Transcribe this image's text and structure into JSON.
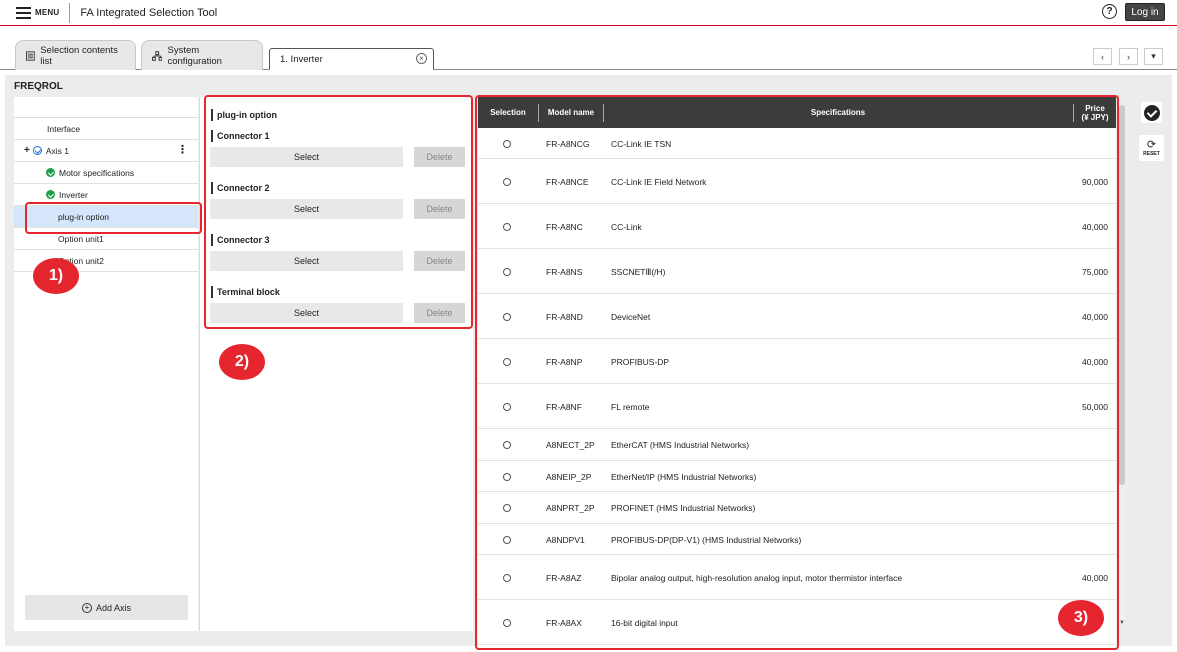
{
  "header": {
    "menu_label": "MENU",
    "app_title": "FA Integrated Selection Tool",
    "help_glyph": "?",
    "login_label": "Log in"
  },
  "tabs": [
    {
      "label": "Selection contents list"
    },
    {
      "label": "System configuration"
    },
    {
      "label": "1. Inverter"
    }
  ],
  "nav": {
    "prev": "‹",
    "next": "›",
    "more": "▾"
  },
  "product_family": "FREQROL",
  "tree": {
    "items": [
      {
        "label": "Interface"
      },
      {
        "label": "Axis 1",
        "expand_glyph": "+"
      },
      {
        "label": "Motor specifications"
      },
      {
        "label": "Inverter"
      },
      {
        "label": "plug-in option"
      },
      {
        "label": "Option unit1"
      },
      {
        "label": "Option unit2"
      }
    ],
    "add_axis_label": "Add Axis"
  },
  "plugin_panel": {
    "title": "plug-in option",
    "select_label": "Select",
    "delete_label": "Delete",
    "connectors": [
      {
        "label": "Connector 1"
      },
      {
        "label": "Connector 2"
      },
      {
        "label": "Connector 3"
      },
      {
        "label": "Terminal block"
      }
    ]
  },
  "table": {
    "headers": {
      "selection": "Selection",
      "model": "Model name",
      "spec": "Specifications",
      "price": "Price",
      "price_unit": "(¥ JPY)"
    },
    "rows": [
      {
        "model": "FR-A8NCG",
        "spec": "CC-Link IE TSN",
        "price": ""
      },
      {
        "model": "FR-A8NCE",
        "spec": "CC-Link IE Field Network",
        "price": "90,000"
      },
      {
        "model": "FR-A8NC",
        "spec": "CC-Link",
        "price": "40,000"
      },
      {
        "model": "FR-A8NS",
        "spec": "SSCNETⅢ(/H)",
        "price": "75,000"
      },
      {
        "model": "FR-A8ND",
        "spec": "DeviceNet",
        "price": "40,000"
      },
      {
        "model": "FR-A8NP",
        "spec": "PROFIBUS-DP",
        "price": "40,000"
      },
      {
        "model": "FR-A8NF",
        "spec": "FL remote",
        "price": "50,000"
      },
      {
        "model": "A8NECT_2P",
        "spec": "EtherCAT (HMS Industrial Networks)",
        "price": ""
      },
      {
        "model": "A8NEIP_2P",
        "spec": "EtherNet/IP (HMS Industrial Networks)",
        "price": ""
      },
      {
        "model": "A8NPRT_2P",
        "spec": "PROFINET (HMS Industrial Networks)",
        "price": ""
      },
      {
        "model": "A8NDPV1",
        "spec": "PROFIBUS-DP(DP-V1) (HMS Industrial Networks)",
        "price": ""
      },
      {
        "model": "FR-A8AZ",
        "spec": "Bipolar analog output, high-resolution analog input, motor thermistor interface",
        "price": "40,000"
      },
      {
        "model": "FR-A8AX",
        "spec": "16-bit digital input",
        "price": ""
      }
    ]
  },
  "side": {
    "reset_label": "RESET",
    "reset_glyph": "⟳"
  },
  "annotations": [
    {
      "label": "1)"
    },
    {
      "label": "2)"
    },
    {
      "label": "3)"
    }
  ],
  "colors": {
    "accent_red": "#e5262f",
    "header_line": "#d6001c",
    "table_header": "#3c3c3c",
    "selected_row": "#d6e6fa"
  }
}
